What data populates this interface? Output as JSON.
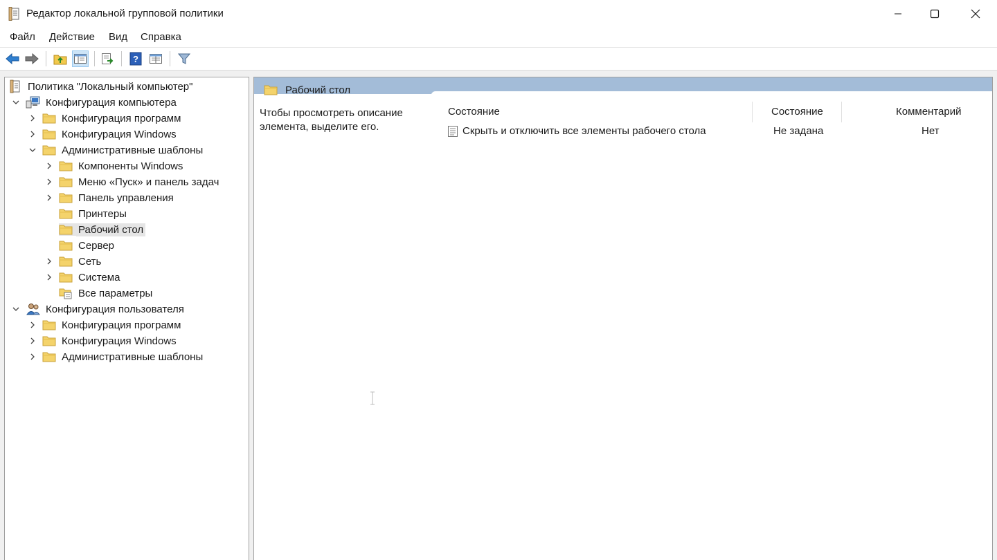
{
  "window": {
    "title": "Редактор локальной групповой политики"
  },
  "menu": [
    "Файл",
    "Действие",
    "Вид",
    "Справка"
  ],
  "toolbar": {
    "buttons": [
      "back-icon",
      "forward-icon",
      "up-folder-icon",
      "show-hide-tree-icon",
      "export-list-icon",
      "help-icon",
      "properties-icon",
      "filter-icon"
    ]
  },
  "tree": {
    "root": "Политика \"Локальный компьютер\"",
    "computer_config": "Конфигурация компьютера",
    "c_software": "Конфигурация программ",
    "c_windows": "Конфигурация Windows",
    "c_admin": "Административные шаблоны",
    "c_admin_items": [
      "Компоненты Windows",
      "Меню «Пуск» и панель задач",
      "Панель управления",
      "Принтеры",
      "Рабочий стол",
      "Сервер",
      "Сеть",
      "Система",
      "Все параметры"
    ],
    "user_config": "Конфигурация пользователя",
    "u_software": "Конфигурация программ",
    "u_windows": "Конфигурация Windows",
    "u_admin": "Административные шаблоны"
  },
  "right": {
    "header_title": "Рабочий стол",
    "description": "Чтобы просмотреть описание элемента, выделите его.",
    "columns": [
      "Состояние",
      "Состояние",
      "Комментарий"
    ],
    "rows": [
      {
        "name": "Скрыть и отключить все элементы рабочего стола",
        "state": "Не задана",
        "comment": "Нет"
      }
    ]
  },
  "colors": {
    "header_bar": "#a3bcd8",
    "selection": "#e5e5e5",
    "folder": "#f4d36b"
  }
}
